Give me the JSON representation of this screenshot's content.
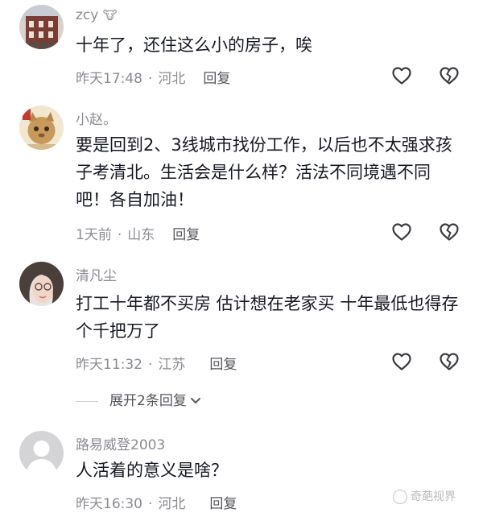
{
  "comments": [
    {
      "username": "zcy",
      "badge": "🐮",
      "text": "十年了，还住这么小的房子，唉",
      "time": "昨天17:48",
      "location": "河北",
      "reply_label": "回复"
    },
    {
      "username": "小赵。",
      "text": "要是回到2、3线城市找份工作，以后也不太强求孩子考清北。生活会是什么样？活法不同境遇不同吧！各自加油！",
      "time": "1天前",
      "location": "山东",
      "reply_label": "回复"
    },
    {
      "username": "清凡尘",
      "text": "打工十年都不买房 估计想在老家买 十年最低也得存个千把万了",
      "time": "昨天11:32",
      "location": "江苏",
      "reply_label": "回复"
    },
    {
      "username": "路易威登2003",
      "text": "人活着的意义是啥？",
      "time": "昨天16:30",
      "location": "河北",
      "reply_label": "回复"
    }
  ],
  "expand_replies": "展开2条回复",
  "separator": "·",
  "watermark": "奇葩视界",
  "icons": {
    "like": "heart-outline-icon",
    "dislike": "broken-heart-icon",
    "expand": "chevron-down-icon"
  },
  "colors": {
    "text": "#161823",
    "meta": "#8a8b91",
    "reply": "#55565c"
  }
}
